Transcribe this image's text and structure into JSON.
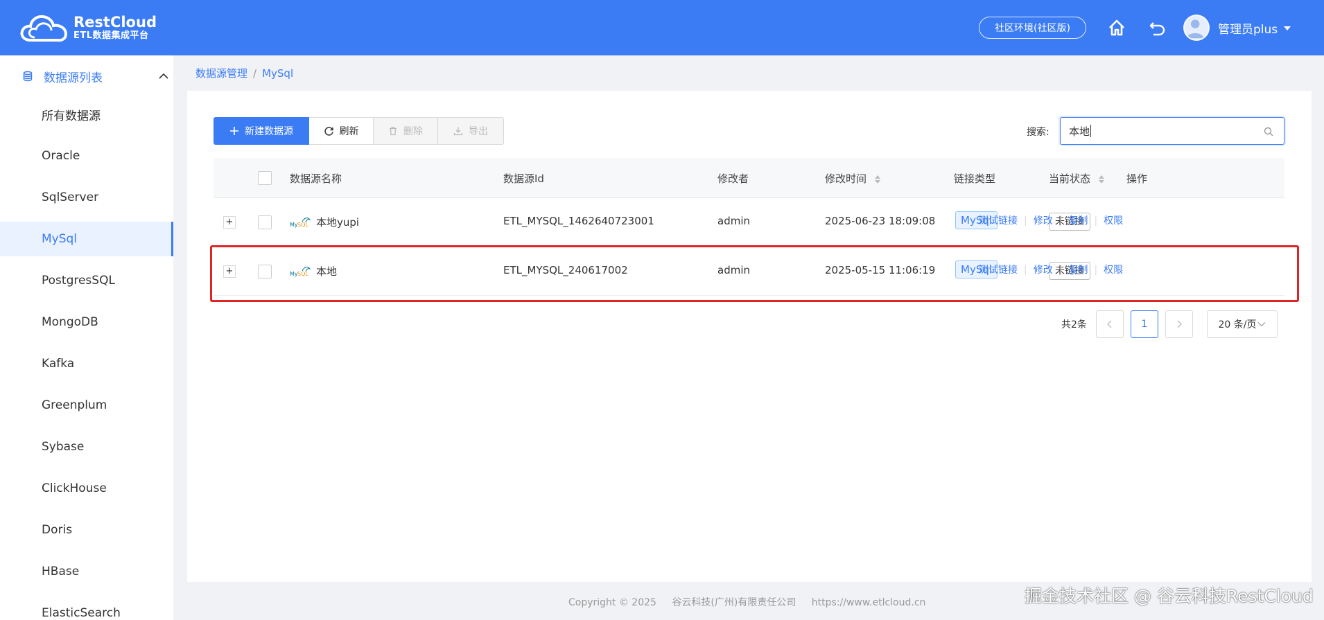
{
  "header": {
    "logo_title": "RestCloud",
    "logo_subtitle": "ETL数据集成平台",
    "env_label": "社区环境(社区版)",
    "user_name": "管理员plus"
  },
  "sidebar": {
    "group_label": "数据源列表",
    "items": [
      {
        "label": "所有数据源"
      },
      {
        "label": "Oracle"
      },
      {
        "label": "SqlServer"
      },
      {
        "label": "MySql",
        "active": true
      },
      {
        "label": "PostgresSQL"
      },
      {
        "label": "MongoDB"
      },
      {
        "label": "Kafka"
      },
      {
        "label": "Greenplum"
      },
      {
        "label": "Sybase"
      },
      {
        "label": "ClickHouse"
      },
      {
        "label": "Doris"
      },
      {
        "label": "HBase"
      },
      {
        "label": "ElasticSearch"
      }
    ]
  },
  "breadcrumb": {
    "root": "数据源管理",
    "separator": "/",
    "current": "MySql"
  },
  "toolbar": {
    "new_label": "新建数据源",
    "refresh_label": "刷新",
    "delete_label": "删除",
    "export_label": "导出"
  },
  "search": {
    "label": "搜索:",
    "value": "本地"
  },
  "table": {
    "columns": {
      "name": "数据源名称",
      "id": "数据源Id",
      "modifier": "修改者",
      "modified_time": "修改时间",
      "link_type": "链接类型",
      "status": "当前状态",
      "actions": "操作"
    },
    "rows": [
      {
        "name": "本地yupi",
        "id": "ETL_MYSQL_1462640723001",
        "modifier": "admin",
        "modified_time": "2025-06-23 18:09:08",
        "link_type": "MySql",
        "status": "未链接"
      },
      {
        "name": "本地",
        "id": "ETL_MYSQL_240617002",
        "modifier": "admin",
        "modified_time": "2025-05-15 11:06:19",
        "link_type": "MySql",
        "status": "未链接"
      }
    ],
    "actions": {
      "test": "测试链接",
      "edit": "修改",
      "copy": "复制",
      "perm": "权限"
    },
    "expand_symbol": "+"
  },
  "pagination": {
    "total": "共2条",
    "current_page": "1",
    "page_size": "20 条/页"
  },
  "footer": {
    "copyright": "Copyright © 2025",
    "company": "谷云科技(广州)有限责任公司",
    "url": "https://www.etlcloud.cn"
  },
  "watermark": "掘金技术社区 @ 谷云科技RestCloud",
  "colors": {
    "primary": "#3b7cf5",
    "highlight_border": "#e02424"
  }
}
